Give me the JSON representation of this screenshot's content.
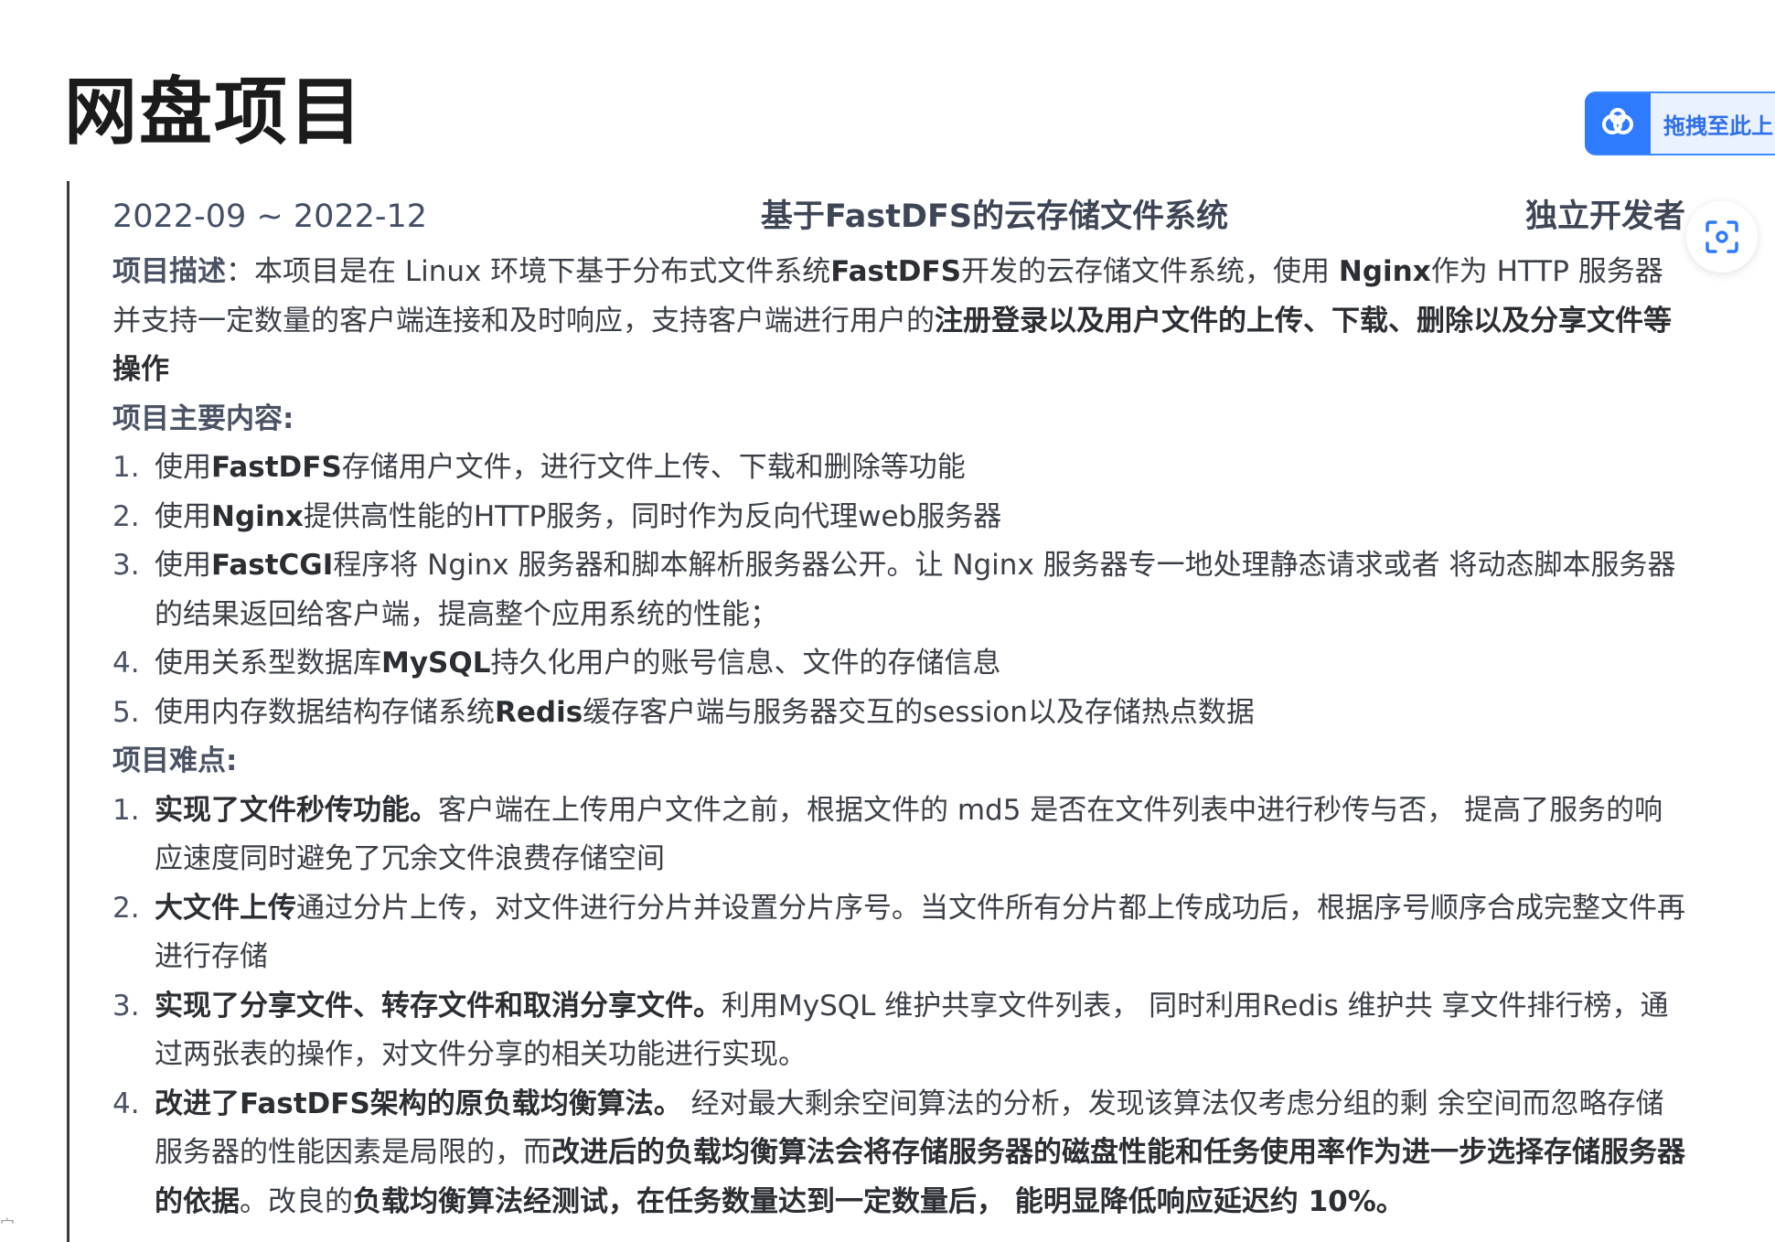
{
  "page": {
    "title": "网盘项目"
  },
  "widgets": {
    "upload_label": "拖拽至此上",
    "cloud_icon": "cloud-icon",
    "scan_icon": "scan-icon",
    "accent": "#2f7bff"
  },
  "project": {
    "period": "2022-09 ~ 2022-12",
    "name": "基于FastDFS的云存储文件系统",
    "role": "独立开发者",
    "description_label": "项目描述",
    "description": {
      "p1": "：本项目是在 Linux 环境下基于分布式文件系统",
      "b1": "FastDFS",
      "p2": "开发的云存储文件系统，使用 ",
      "b2": "Nginx",
      "p3": "作为 HTTP 服务器并支持一定数量的客户端连接和及时响应，支持客户端进行用户的",
      "b3": "注册登录以及用户文件的上传、下载、删除以及分享文件等操作"
    },
    "content_label": "项目主要内容:",
    "content_items": [
      {
        "num": "1.",
        "a": "使用",
        "b": "FastDFS",
        "c": "存储用户文件，进行文件上传、下载和删除等功能"
      },
      {
        "num": "2.",
        "a": "使用",
        "b": "Nginx",
        "c": "提供高性能的HTTP服务，同时作为反向代理web服务器"
      },
      {
        "num": "3.",
        "a": "使用",
        "b": "FastCGI",
        "c": "程序将 Nginx 服务器和脚本解析服务器公开。让 Nginx 服务器专一地处理静态请求或者 将动态脚本服务器的结果返回给客户端，提高整个应用系统的性能；"
      },
      {
        "num": "4.",
        "a": "使用关系型数据库",
        "b": "MySQL",
        "c": "持久化用户的账号信息、文件的存储信息"
      },
      {
        "num": "5.",
        "a": "使用内存数据结构存储系统",
        "b": "Redis",
        "c": "缓存客户端与服务器交互的session以及存储热点数据"
      }
    ],
    "difficulty_label": "项目难点:",
    "difficulty_items": [
      {
        "num": "1.",
        "b": "实现了文件秒传功能。",
        "c": "客户端在上传用户文件之前，根据文件的 md5 是否在文件列表中进行秒传与否， 提高了服务的响应速度同时避免了冗余文件浪费存储空间"
      },
      {
        "num": "2.",
        "b": "大文件上传",
        "c": "通过分片上传，对文件进行分片并设置分片序号。当文件所有分片都上传成功后，根据序号顺序合成完整文件再进行存储"
      },
      {
        "num": "3.",
        "b": "实现了分享文件、转存文件和取消分享文件。",
        "c": "利用MySQL 维护共享文件列表， 同时利用Redis 维护共 享文件排行榜，通过两张表的操作，对文件分享的相关功能进行实现。"
      },
      {
        "num": "4.",
        "b": "改进了FastDFS架构的原负载均衡算法。",
        "c": " 经对最大剩余空间算法的分析，发现该算法仅考虑分组的剩 余空间而忽略存储服务器的性能因素是局限的，而",
        "b2": "改进后的负载均衡算法会将存储服务器的磁盘性能和任务使用率作为进一步选择存储服务器的依据",
        "c2": "。改良的",
        "b3": "负载均衡算法经测试，在任务数量达到一定数量后， 能明显降低响应延迟约 10%。"
      }
    ]
  },
  "edge": {
    "fragment": "宀"
  }
}
